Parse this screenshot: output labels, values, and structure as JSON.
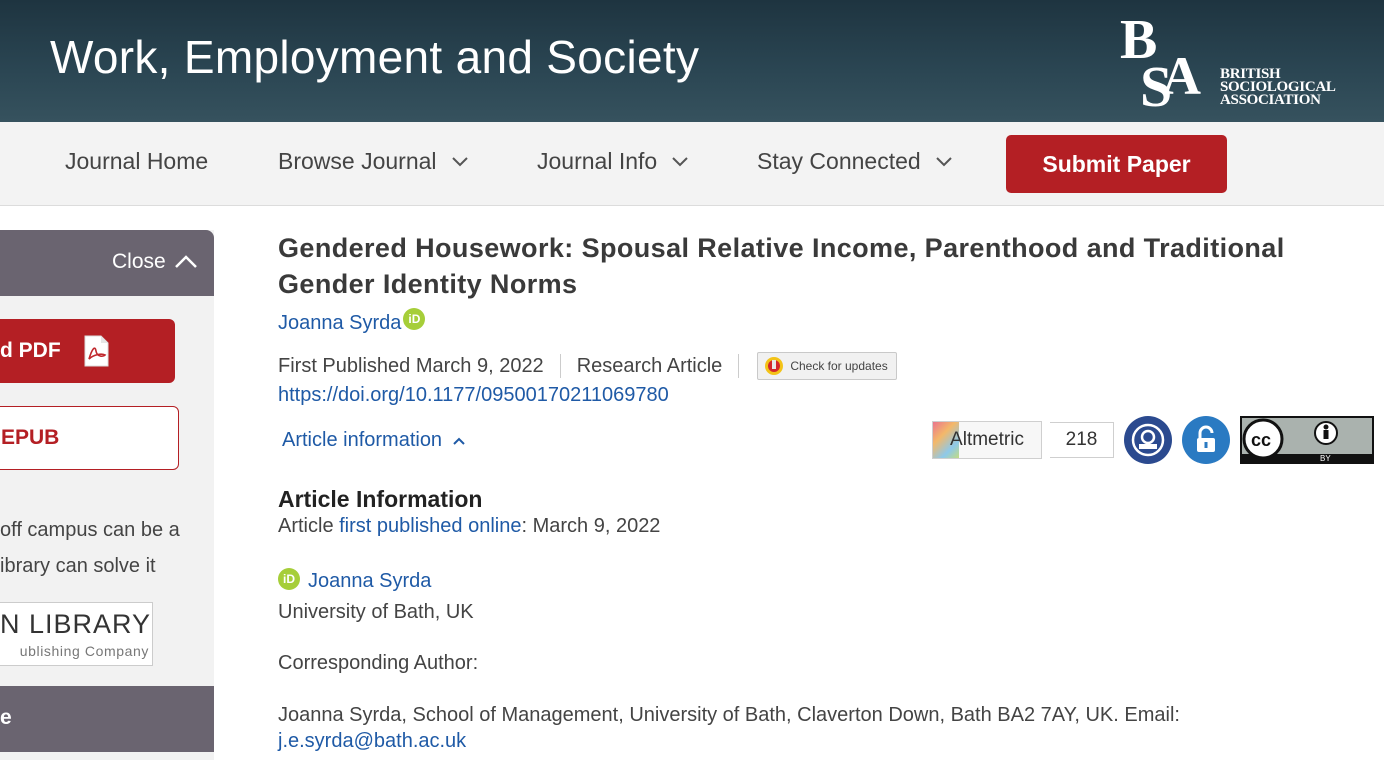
{
  "header": {
    "journal_title": "Work, Employment and Society",
    "logo_letters": "BSA",
    "logo_text": [
      "BRITISH",
      "SOCIOLOGICAL",
      "ASSOCIATION"
    ]
  },
  "nav": {
    "items": [
      {
        "label": "Journal Home",
        "has_dropdown": false
      },
      {
        "label": "Browse Journal",
        "has_dropdown": true
      },
      {
        "label": "Journal Info",
        "has_dropdown": true
      },
      {
        "label": "Stay Connected",
        "has_dropdown": true
      }
    ],
    "submit_label": "Submit Paper"
  },
  "sidebar": {
    "close_label": "Close",
    "pdf_label": "d PDF",
    "epub_label": "EPUB",
    "note_line1": "off campus can be a",
    "note_line2": "ibrary can solve it",
    "library_main": "N LIBRARY",
    "library_sub": "ublishing Company",
    "footer_label": "e"
  },
  "article": {
    "title": "Gendered Housework: Spousal Relative Income, Parenthood and Traditional Gender Identity Norms",
    "author": "Joanna Syrda",
    "orcid_label": "iD",
    "first_published": "First Published March 9, 2022",
    "article_type": "Research Article",
    "check_updates": "Check for updates",
    "doi": "https://doi.org/10.1177/09500170211069780",
    "article_info_toggle": "Article information",
    "altmetric_label": "Altmetric",
    "altmetric_score": "218",
    "cc_label": "BY"
  },
  "info": {
    "heading": "Article Information",
    "published_prefix": "Article ",
    "published_link": "first published online",
    "published_suffix": ": March 9, 2022",
    "author": "Joanna Syrda",
    "affiliation": "University of Bath, UK",
    "corresponding_label": "Corresponding Author:",
    "corresponding_text": "Joanna Syrda, School of Management, University of Bath, Claverton Down, Bath BA2 7AY, UK. Email:",
    "email": "j.e.syrda@bath.ac.uk"
  },
  "colors": {
    "banner": "#2a4552",
    "accent_red": "#b41f24",
    "link_blue": "#1f5aa6",
    "sidebar_header": "#6a6470",
    "orcid_green": "#a6ce39"
  }
}
